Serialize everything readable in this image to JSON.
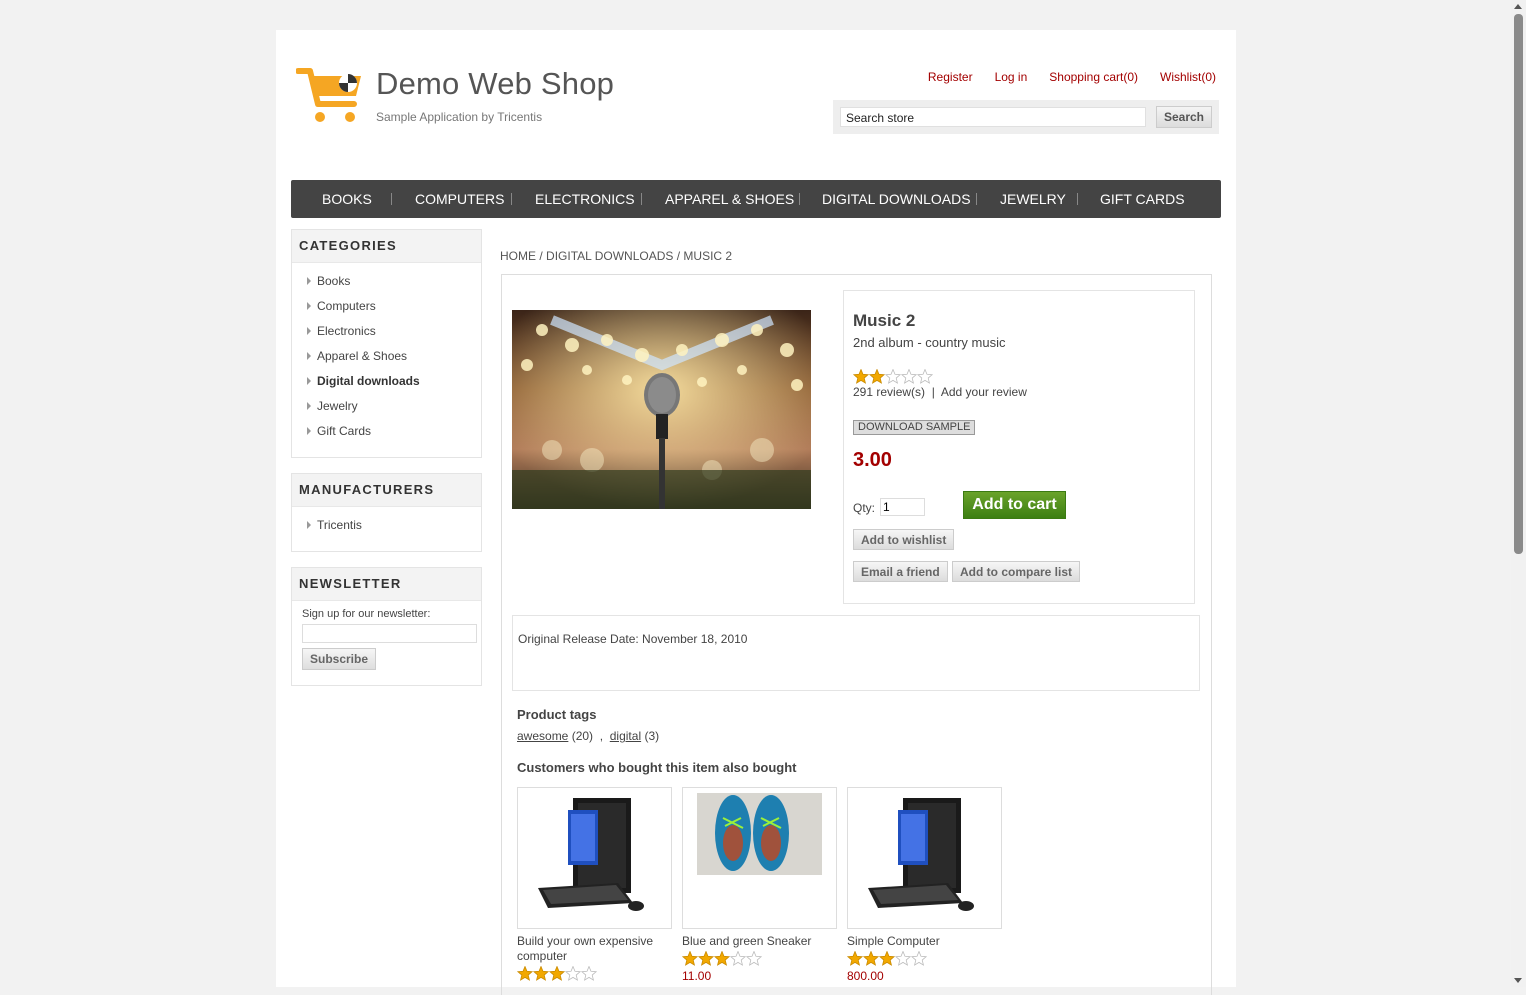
{
  "header": {
    "logo_title": "Demo Web Shop",
    "logo_subtitle": "Sample Application by Tricentis",
    "links": [
      "Register",
      "Log in",
      "Shopping cart(0)",
      "Wishlist(0)"
    ],
    "search_value": "Search store",
    "search_button": "Search"
  },
  "menu": [
    "BOOKS",
    "COMPUTERS",
    "ELECTRONICS",
    "APPAREL & SHOES",
    "DIGITAL DOWNLOADS",
    "JEWELRY",
    "GIFT CARDS"
  ],
  "categories": {
    "title": "CATEGORIES",
    "items": [
      "Books",
      "Computers",
      "Electronics",
      "Apparel & Shoes",
      "Digital downloads",
      "Jewelry",
      "Gift Cards"
    ],
    "active": "Digital downloads"
  },
  "manufacturers": {
    "title": "MANUFACTURERS",
    "items": [
      "Tricentis"
    ]
  },
  "newsletter": {
    "title": "NEWSLETTER",
    "label": "Sign up for our newsletter:",
    "button": "Subscribe"
  },
  "breadcrumb": {
    "home": "HOME",
    "category": "DIGITAL DOWNLOADS",
    "current": "MUSIC 2",
    "sep": "/"
  },
  "product": {
    "name": "Music 2",
    "short_description": "2nd album - country music",
    "rating": 2,
    "rating_max": 5,
    "reviews": "291 review(s)",
    "add_review": "Add your review",
    "download_sample": "DOWNLOAD SAMPLE",
    "price": "3.00",
    "qty_label": "Qty:",
    "qty_value": "1",
    "add_to_cart": "Add to cart",
    "add_to_wishlist": "Add to wishlist",
    "email_friend": "Email a friend",
    "add_compare": "Add to compare list",
    "full_description": "Original Release Date: November 18, 2010"
  },
  "tags": {
    "title": "Product tags",
    "items": [
      {
        "name": "awesome",
        "count": "(20)"
      },
      {
        "name": "digital",
        "count": "(3)"
      }
    ]
  },
  "also_bought": {
    "title": "Customers who bought this item also bought",
    "items": [
      {
        "name": "Build your own expensive computer",
        "price": "",
        "rating": 3
      },
      {
        "name": "Blue and green Sneaker",
        "price": "11.00",
        "rating": 3
      },
      {
        "name": "Simple Computer",
        "price": "800.00",
        "rating": 3
      }
    ]
  },
  "colors": {
    "accent": "#a30000",
    "menu_bg": "#444444",
    "cart_green": "#4a8f1c",
    "star": "#f2a800"
  }
}
